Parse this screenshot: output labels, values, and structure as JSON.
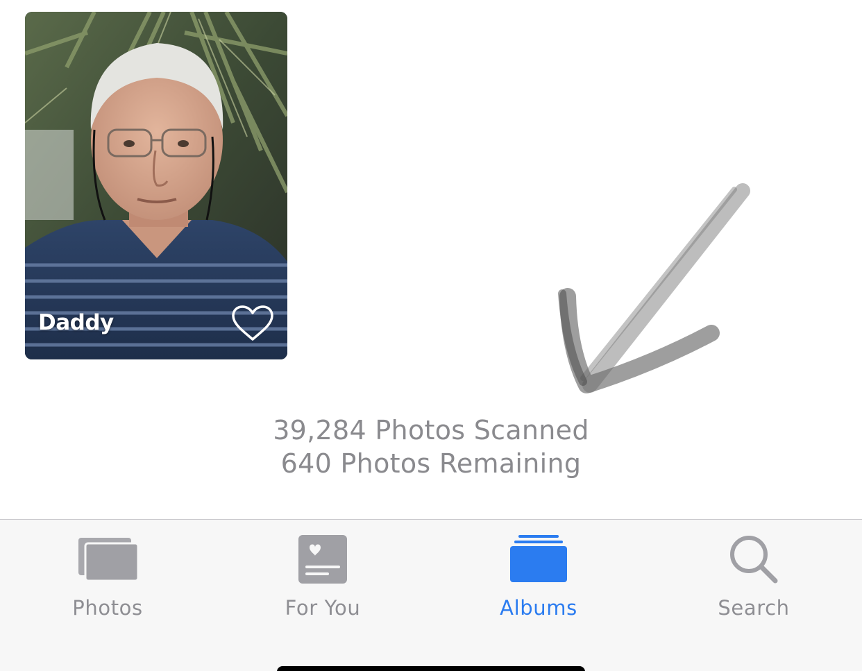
{
  "person": {
    "name": "Daddy",
    "favorite_icon": "heart-outline-icon"
  },
  "scan": {
    "scanned": "39,284 Photos Scanned",
    "remaining": "640 Photos Remaining"
  },
  "tabs": [
    {
      "label": "Photos",
      "icon": "photos-icon",
      "active": false
    },
    {
      "label": "For You",
      "icon": "for-you-icon",
      "active": false
    },
    {
      "label": "Albums",
      "icon": "albums-icon",
      "active": true
    },
    {
      "label": "Search",
      "icon": "search-icon",
      "active": false
    }
  ],
  "colors": {
    "accent": "#2b7cf0",
    "inactive": "#8e8e93",
    "status_text": "#8a8a8e",
    "tab_bar_bg": "#f7f7f7"
  }
}
